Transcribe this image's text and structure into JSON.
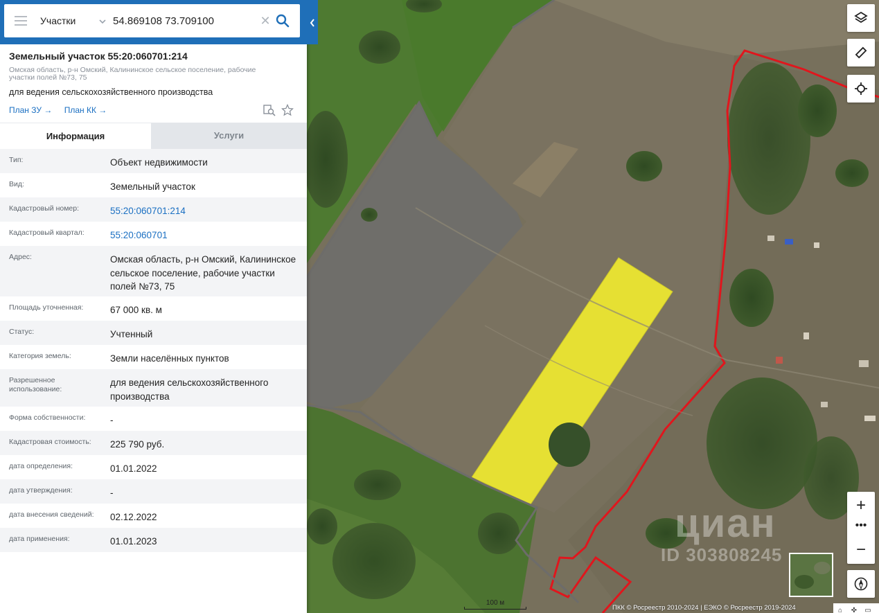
{
  "search": {
    "type_label": "Участки",
    "query": "54.869108 73.709100",
    "clear_glyph": "✕"
  },
  "parcel": {
    "title": "Земельный участок 55:20:060701:214",
    "address": "Омская область, р-н Омский, Калининское сельское поселение, рабочие участки полей №73, 75",
    "usage": "для ведения сельскохозяйственного производства",
    "link_plan_zu": "План ЗУ →",
    "link_plan_kk": "План КК →"
  },
  "tabs": {
    "info": "Информация",
    "services": "Услуги"
  },
  "info_rows": [
    {
      "label": "Тип:",
      "value": "Объект недвижимости"
    },
    {
      "label": "Вид:",
      "value": "Земельный участок"
    },
    {
      "label": "Кадастровый номер:",
      "value": "55:20:060701:214"
    },
    {
      "label": "Кадастровый квартал:",
      "value": "55:20:060701"
    },
    {
      "label": "Адрес:",
      "value": "Омская область, р-н Омский, Калининское сельское поселение, рабочие участки полей №73, 75"
    },
    {
      "label": "Площадь уточненная:",
      "value": "67 000 кв. м"
    },
    {
      "label": "Статус:",
      "value": "Учтенный"
    },
    {
      "label": "Категория земель:",
      "value": "Земли населённых пунктов"
    },
    {
      "label": "Разрешенное использование:",
      "value": "для ведения сельскохозяйственного производства"
    },
    {
      "label": "Форма собственности:",
      "value": "-"
    },
    {
      "label": "Кадастровая стоимость:",
      "value": "225 790 руб."
    },
    {
      "label": "дата определения:",
      "value": "01.01.2022"
    },
    {
      "label": "дата утверждения:",
      "value": "-"
    },
    {
      "label": "дата внесения сведений:",
      "value": "02.12.2022"
    },
    {
      "label": "дата применения:",
      "value": "01.01.2023"
    }
  ],
  "map": {
    "zoom_in": "+",
    "zoom_out": "−",
    "zoom_more": "•••",
    "scale_label": "100 м",
    "attribution": "ПКК © Росреестр 2010-2024 | ЕЭКО © Росреестр 2019-2024",
    "watermark_brand": "циан",
    "watermark_id": "ID 303808245",
    "icons": [
      "layers-icon",
      "ruler-icon",
      "locate-icon",
      "compass-icon"
    ]
  },
  "colors": {
    "header_blue": "#1f6fb8",
    "link_blue": "#1a6fc2",
    "parcel_fill": "#e6e033",
    "boundary_red": "#e0161d"
  }
}
